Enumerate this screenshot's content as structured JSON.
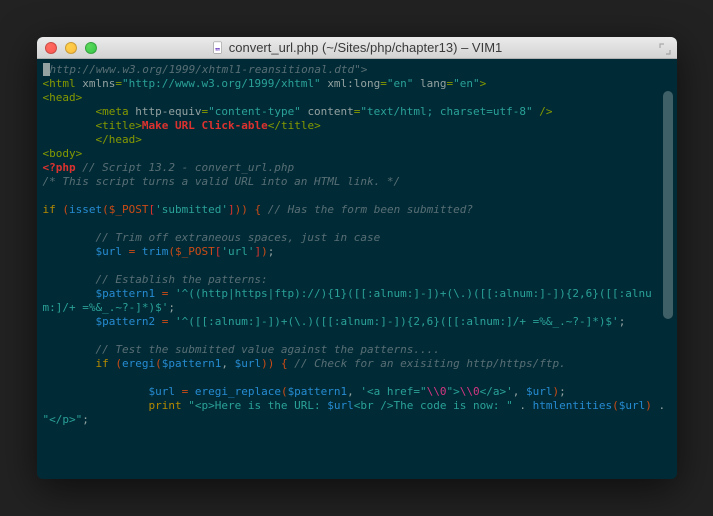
{
  "window": {
    "title": "convert_url.php (~/Sites/php/chapter13) – VIM1"
  },
  "code": {
    "l1_dtd": "http://www.w3.org/1999/xhtml1-reansitional.dtd",
    "l2_html": "html",
    "l2_xmlns_attr": "xmlns",
    "l2_xmlns_val": "\"http://www.w3.org/1999/xhtml\"",
    "l2_xmllong_attr": "xml:long",
    "l2_en1": "\"en\"",
    "l2_lang_attr": "lang",
    "l2_en2": "\"en\"",
    "l3_head": "head",
    "l4_meta": "meta",
    "l4_httpequiv_attr": "http-equiv",
    "l4_ct": "\"content-type\"",
    "l4_content_attr": "content",
    "l4_ctv": "\"text/html; charset=utf-8\"",
    "l5_title": "title",
    "l5_title_text": "Make URL Click-able",
    "l5_title_close": "title",
    "l6_head_close": "head",
    "l7_body": "body",
    "l8_php": "<?php",
    "l8_comment": "// Script 13.2 - convert_url.php",
    "l9_comment": "/* This script turns a valid URL into an HTML link. */",
    "l11_if": "if",
    "l11_isset": "isset",
    "l11_post": "$_POST",
    "l11_key": "'submitted'",
    "l11_comment": "// Has the form been submitted?",
    "l13_comment": "// Trim off extraneous spaces, just in case",
    "l14_url": "$url",
    "l14_eq": "=",
    "l14_trim": "trim",
    "l14_post": "$_POST",
    "l14_key": "'url'",
    "l16_comment": "// Establish the patterns:",
    "l17_p1": "$pattern1",
    "l17_eq": "=",
    "l17_val": "'^((http|https|ftp)://){1}([[:alnum:]-])+(\\.)([[:alnum:]-]){2,6}([[:alnum:]/+ =%&_.~?-]*)$'",
    "l18_p2": "$pattern2",
    "l18_eq": "=",
    "l18_val": "'^([[:alnum:]-])+(\\.)([[:alnum:]-]){2,6}([[:alnum:]/+ =%&_.~?-]*)$'",
    "l20_comment": "// Test the submitted value against the patterns....",
    "l21_if": "if",
    "l21_eregi": "eregi",
    "l21_p1": "$pattern1",
    "l21_url": "$url",
    "l21_comment": "// Check for an exisiting http/https/ftp.",
    "l23_url": "$url",
    "l23_eq": "=",
    "l23_fn": "eregi_replace",
    "l23_a1": "$pattern1",
    "l23_a2a": "'<a href=\"",
    "l23_a2b": "\\\\0",
    "l23_a2c": "\">",
    "l23_a2d": "\\\\0",
    "l23_a2e": "</a>'",
    "l23_a3": "$url",
    "l24_print": "print",
    "l24_str1": "\"<p>Here is the URL: ",
    "l24_var1": "$url",
    "l24_str2": "<br />The code is now: \"",
    "l24_dot": ".",
    "l24_fn": "htmlentities",
    "l24_arg": "$url",
    "l24_str3": "\"</p>\""
  }
}
